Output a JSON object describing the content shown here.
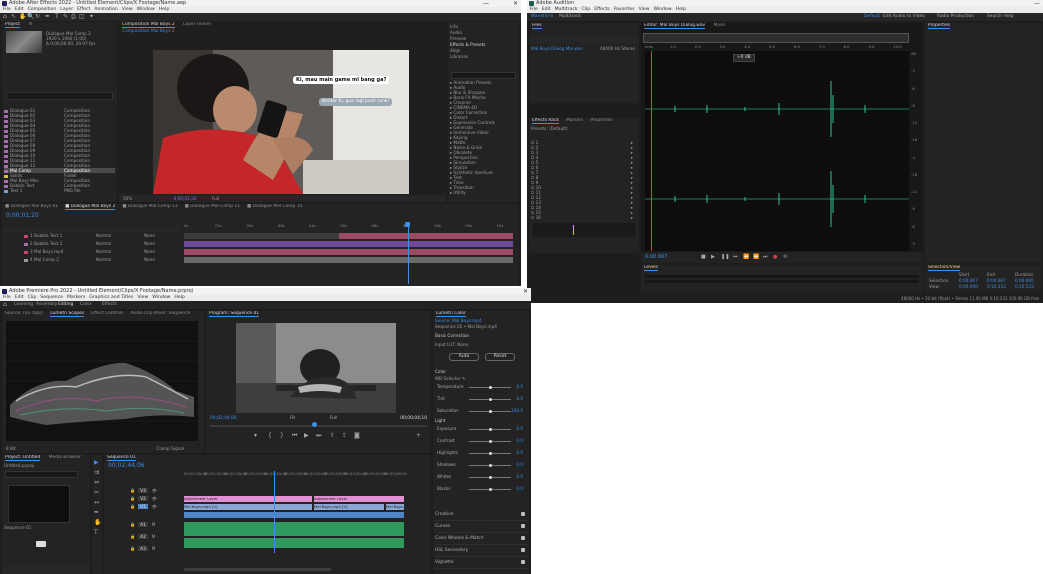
{
  "after_effects": {
    "title": "Adobe After Effects 2022 - Untitled Element/Clips/X Footage/Name.aep",
    "menu": [
      "File",
      "Edit",
      "Composition",
      "Layer",
      "Effect",
      "Animation",
      "View",
      "Window",
      "Help"
    ],
    "project_tab": "Project",
    "comp_tab": "Composition Mal Boys 2",
    "layer_tab": "Layer (none)",
    "comp_tabs": [
      "Composition Mal Boys 2",
      "Footage (none)"
    ],
    "project_info": [
      "Dialogue Mal Comp 2",
      "1920 x 1080 (1.00)",
      "Δ 0;00;06;00, 29.97 fps"
    ],
    "project_items": [
      "Dialogue 01",
      "Dialogue 02",
      "Dialogue 03",
      "Dialogue 04",
      "Dialogue 05",
      "Dialogue 06",
      "Dialogue 07",
      "Dialogue 08",
      "Dialogue 09",
      "Dialogue 10",
      "Dialogue 11",
      "Dialogue 12",
      "Mal Comp",
      "Solids",
      "Mal Boys Mov",
      "Bubble Text",
      "Text 1"
    ],
    "project_kinds": [
      "Composition",
      "Composition",
      "Composition",
      "Composition",
      "Composition",
      "Composition",
      "Composition",
      "Composition",
      "Composition",
      "Composition",
      "Composition",
      "Composition",
      "Composition",
      "Folder",
      "Composition",
      "Composition",
      "PNG file"
    ],
    "bubble1": "Ki, mau main game ml bang ga?",
    "bubble2": "Bentar Ki, gue lagi push rank!",
    "right_tabs": [
      "Info",
      "Audio",
      "Preview",
      "Effects & Presets",
      "Align",
      "Libraries",
      "Character",
      "Paragraph",
      "Tracker",
      "Content-Aware Fill",
      "Motion Sketch",
      "Smoother",
      "Wiggler",
      "Mask Interpolation",
      "Essential Graphics",
      "Brush",
      "Paint",
      "Properties"
    ],
    "right_list": [
      "Animation Presets",
      "Audio",
      "Blur & Sharpen",
      "Boris FX Mocha",
      "Channel",
      "CINEMA 4D",
      "Color Correction",
      "Distort",
      "Expression Controls",
      "Generate",
      "Immersive Video",
      "Keying",
      "Matte",
      "Noise & Grain",
      "Obsolete",
      "Perspective",
      "Simulation",
      "Stylize",
      "Synthetic Aperture",
      "Text",
      "Time",
      "Transition",
      "Utility"
    ],
    "timeline_tabs": [
      "Dialogue Mal Boys 01",
      "Dialogue Mal Boys 2",
      "Dialogue Mal Comp 13",
      "Dialogue Mal Comp 11",
      "Dialogue Mal Comp 14"
    ],
    "timecode": "0;00;01;20",
    "zoom": "50%",
    "quality": "Full",
    "layers": [
      "Bubble Text 1",
      "Bubble Text 2",
      "Mal Boys.mp4",
      "Mal Comp 2"
    ],
    "layer_modes": [
      "Normal",
      "Normal",
      "Normal",
      "Normal"
    ],
    "parent": [
      "None",
      "None",
      "None",
      "None"
    ],
    "ruler": [
      "0s",
      "01s",
      "02s",
      "03s",
      "04s",
      "05s",
      "06s",
      "07s",
      "08s",
      "09s",
      "10s"
    ]
  },
  "audition": {
    "title": "Adobe Audition",
    "menu": [
      "File",
      "Edit",
      "Multitrack",
      "Clip",
      "Effects",
      "Favorites",
      "View",
      "Window",
      "Help"
    ],
    "workspace": [
      "Waveform",
      "Multitrack"
    ],
    "workspace_right": [
      "Default",
      "Edit Audio to Video",
      "Radio Production",
      "Search Help"
    ],
    "files_tab": "Files",
    "file_name": "Mal Boys Dialog Mix.wav",
    "file_meta": "48000 Hz Stereo",
    "editor_tab": "Editor: Mal Boys Dialog.wav",
    "mixer_tab": "Mixer",
    "timecode": "0:00.667",
    "gain": "+0 dB",
    "ruler": [
      "hms",
      "1.0",
      "2.0",
      "3.0",
      "4.0",
      "5.0",
      "6.0",
      "7.0",
      "8.0",
      "9.0",
      "10.0"
    ],
    "db_scale": [
      "dB",
      "-3",
      "-6",
      "-9",
      "-12",
      "-18",
      "-∞",
      "-18",
      "-12",
      "-9",
      "-6",
      "-3"
    ],
    "effects_tabs": [
      "Effects Rack",
      "Markers",
      "Properties"
    ],
    "presets_label": "Presets: (Default)",
    "rack_slots": [
      "1",
      "2",
      "3",
      "4",
      "5",
      "6",
      "7",
      "8",
      "9",
      "10",
      "11",
      "12",
      "13",
      "14",
      "15",
      "16"
    ],
    "levels_tab": "Levels",
    "selection_tab": "Selection/View",
    "selection_rows": [
      "Selection",
      "View"
    ],
    "selection_headers": [
      "Start",
      "End",
      "Duration"
    ],
    "selection_values": [
      [
        "0:00.667",
        "0:00.667",
        "0:00.000"
      ],
      [
        "0:00.000",
        "0:10.533",
        "0:10.533"
      ]
    ],
    "status": "48000 Hz • 32-bit (float) • Stereo   11.00 MB   0:10.533   100.96 GB free"
  },
  "premiere": {
    "title": "Adobe Premiere Pro 2022 - Untitled Element/Clips/X Footage/Name.prproj",
    "menu": [
      "File",
      "Edit",
      "Clip",
      "Sequence",
      "Markers",
      "Graphics and Titles",
      "View",
      "Window",
      "Help"
    ],
    "top_tabs": [
      "Learning",
      "Assembly",
      "Editing",
      "Color",
      "Effects"
    ],
    "left_tabs": [
      "Source: (no clips)",
      "Lumetri Scopes",
      "Effect Controls",
      "Audio Clip Mixer: Sequence"
    ],
    "program_tab": "Program: Sequence 01",
    "program_tc": "00;02;44;06",
    "program_duration": "00;00;04;10",
    "fit": "Fit",
    "res": "Full",
    "scope_footer": "8 Bit",
    "scope_setting": "Clamp Signal",
    "project_tab": "Project: Untitled",
    "media_tab": "Media Browser",
    "project_file": "Untitled.prproj",
    "seq_tab": "Sequence 01",
    "seq_tc": "00;02;44;06",
    "ruler": [
      "00;02;28;00",
      "00;02;32;00",
      "00;02;36;00",
      "00;02;40;00",
      "00;02;44;00",
      "00;02;48;00",
      "00;02;52;00",
      "00;02;56;00",
      "00;03;00;00",
      "00;03;04;00",
      "00;03;08;00"
    ],
    "tracks": [
      "V3",
      "V2",
      "V1",
      "A1",
      "A2",
      "A3"
    ],
    "clips_v2": [
      "Adjustment Layer",
      "Adjustment Layer"
    ],
    "clips_v1": [
      "Mal Boys.mp4 [V]",
      "Mal Boys.mp4 [V]",
      "Mal Boys.mp4 [V]"
    ],
    "lumetri_tab": "Lumetri Color",
    "lumetri_clip": "Source: Mal Boys.mp4",
    "lumetri_seq": "Sequence 01 • Mal Boys.mp4",
    "basic": "Basic Correction",
    "input_lut": "Input LUT: None",
    "auto_btn": "Auto",
    "reset_btn": "Reset",
    "color_label": "Color",
    "light_label": "Light",
    "wb": "WB Selector",
    "props": [
      {
        "name": "Temperature",
        "val": "0.0",
        "pos": 0.5
      },
      {
        "name": "Tint",
        "val": "0.0",
        "pos": 0.5
      },
      {
        "name": "Saturation",
        "val": "100.0",
        "pos": 0.5
      },
      {
        "name": "Exposure",
        "val": "0.0",
        "pos": 0.5
      },
      {
        "name": "Contrast",
        "val": "0.0",
        "pos": 0.5
      },
      {
        "name": "Highlights",
        "val": "0.0",
        "pos": 0.5
      },
      {
        "name": "Shadows",
        "val": "0.0",
        "pos": 0.5
      },
      {
        "name": "Whites",
        "val": "0.0",
        "pos": 0.5
      },
      {
        "name": "Blacks",
        "val": "0.0",
        "pos": 0.5
      }
    ],
    "sections": [
      "Creative",
      "Curves",
      "Color Wheels & Match",
      "HSL Secondary",
      "Vignette"
    ]
  }
}
